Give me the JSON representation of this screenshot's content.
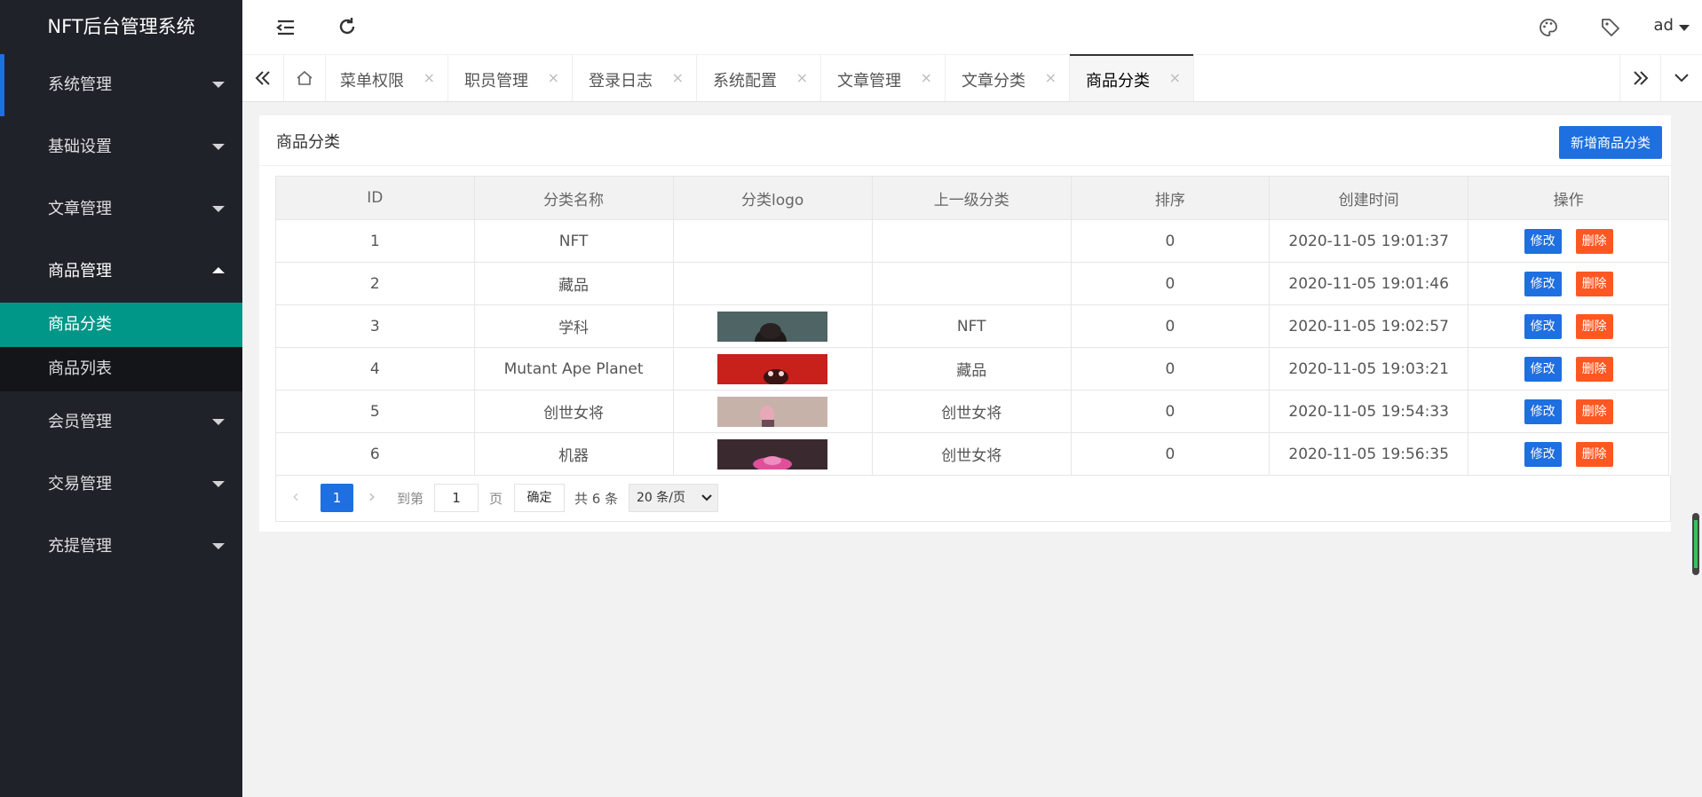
{
  "app": {
    "title": "NFT后台管理系统"
  },
  "sidebar": {
    "items": [
      {
        "label": "系统管理"
      },
      {
        "label": "基础设置"
      },
      {
        "label": "文章管理"
      },
      {
        "label": "商品管理"
      },
      {
        "label": "会员管理"
      },
      {
        "label": "交易管理"
      },
      {
        "label": "充提管理"
      }
    ],
    "submenu": [
      {
        "label": "商品分类"
      },
      {
        "label": "商品列表"
      }
    ]
  },
  "header": {
    "user": "ad"
  },
  "tabs": [
    {
      "label": "菜单权限"
    },
    {
      "label": "职员管理"
    },
    {
      "label": "登录日志"
    },
    {
      "label": "系统配置"
    },
    {
      "label": "文章管理"
    },
    {
      "label": "文章分类"
    },
    {
      "label": "商品分类"
    }
  ],
  "tab_close": "×",
  "card": {
    "title": "商品分类",
    "add_button": "新增商品分类"
  },
  "table": {
    "columns": [
      "ID",
      "分类名称",
      "分类logo",
      "上一级分类",
      "排序",
      "创建时间",
      "操作"
    ],
    "rows": [
      {
        "id": "1",
        "name": "NFT",
        "parent": "",
        "sort": "0",
        "created": "2020-11-05 19:01:37"
      },
      {
        "id": "2",
        "name": "藏品",
        "parent": "",
        "sort": "0",
        "created": "2020-11-05 19:01:46"
      },
      {
        "id": "3",
        "name": "学科",
        "parent": "NFT",
        "sort": "0",
        "created": "2020-11-05 19:02:57"
      },
      {
        "id": "4",
        "name": "Mutant Ape Planet",
        "parent": "藏品",
        "sort": "0",
        "created": "2020-11-05 19:03:21"
      },
      {
        "id": "5",
        "name": "创世女将",
        "parent": "创世女将",
        "sort": "0",
        "created": "2020-11-05 19:54:33"
      },
      {
        "id": "6",
        "name": "机器",
        "parent": "创世女将",
        "sort": "0",
        "created": "2020-11-05 19:56:35"
      }
    ],
    "edit_label": "修改",
    "delete_label": "删除"
  },
  "pager": {
    "current": "1",
    "goto_label": "到第",
    "goto_value": "1",
    "page_unit": "页",
    "confirm": "确定",
    "total": "共 6 条",
    "page_size": "20 条/页"
  },
  "colors": {
    "sidebar_bg": "#20222a",
    "submenu_active": "#009688",
    "primary": "#1e6fe0",
    "danger": "#ff5722"
  }
}
